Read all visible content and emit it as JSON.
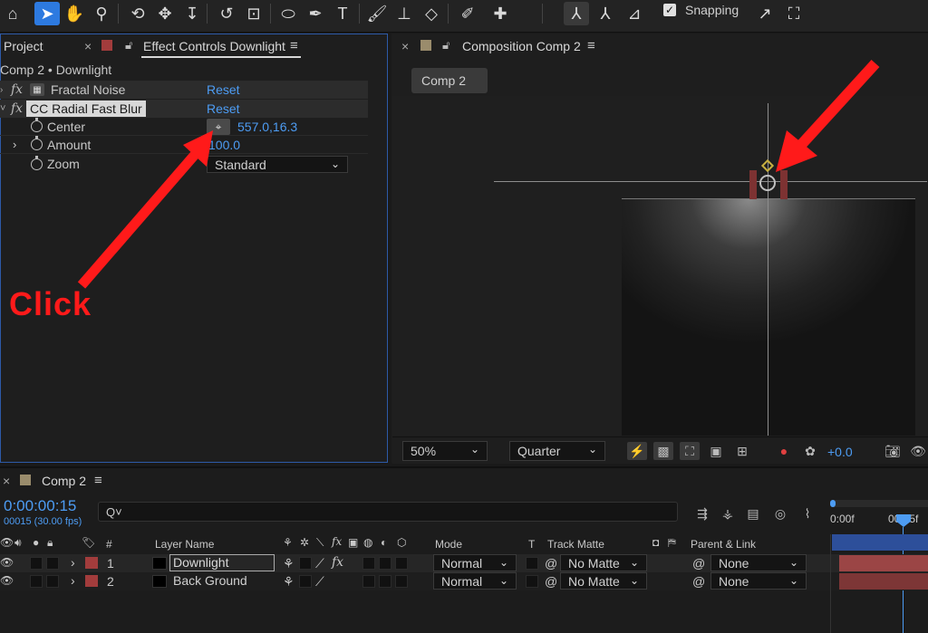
{
  "toolbar": {
    "snapping_label": "Snapping"
  },
  "effect_panel": {
    "project_tab": "Project",
    "close_glyph": "×",
    "tab_title": "Effect Controls Downlight",
    "subtitle": "Comp 2 • Downlight",
    "effects": [
      {
        "fx": "fx",
        "name": "Fractal Noise",
        "reset": "Reset"
      },
      {
        "fx": "fx",
        "name": "CC Radial Fast Blur",
        "reset": "Reset"
      }
    ],
    "properties": {
      "center_label": "Center",
      "center_value": "557.0,16.3",
      "amount_label": "Amount",
      "amount_value": "100.0",
      "zoom_label": "Zoom",
      "zoom_value": "Standard"
    },
    "annotation": "Click"
  },
  "comp_panel": {
    "close_glyph": "×",
    "tab_title": "Composition Comp 2",
    "comp_tab": "Comp 2",
    "footer": {
      "zoom": "50%",
      "resolution": "Quarter",
      "exposure": "+0.0"
    }
  },
  "timeline": {
    "close_glyph": "×",
    "tab_title": "Comp 2",
    "timecode": "0:00:00:15",
    "frame_info": "00015 (30.00 fps)",
    "search_placeholder": "Q˅",
    "ruler_start": "0:00f",
    "ruler_mark": "00:15f",
    "columns": {
      "hash": "#",
      "layer_name": "Layer Name",
      "mode": "Mode",
      "t": "T",
      "track_matte": "Track Matte",
      "parent_link": "Parent & Link"
    },
    "layers": [
      {
        "index": "1",
        "name": "Downlight",
        "mode": "Normal",
        "matte": "No Matte",
        "parent": "None"
      },
      {
        "index": "2",
        "name": "Back Ground",
        "mode": "Normal",
        "matte": "No Matte",
        "parent": "None"
      }
    ]
  },
  "colors": {
    "accent_blue": "#2d7ae0",
    "link_blue": "#4d9cf3",
    "label_red": "#a23c3c",
    "arrow_red": "#ff1a1a"
  }
}
